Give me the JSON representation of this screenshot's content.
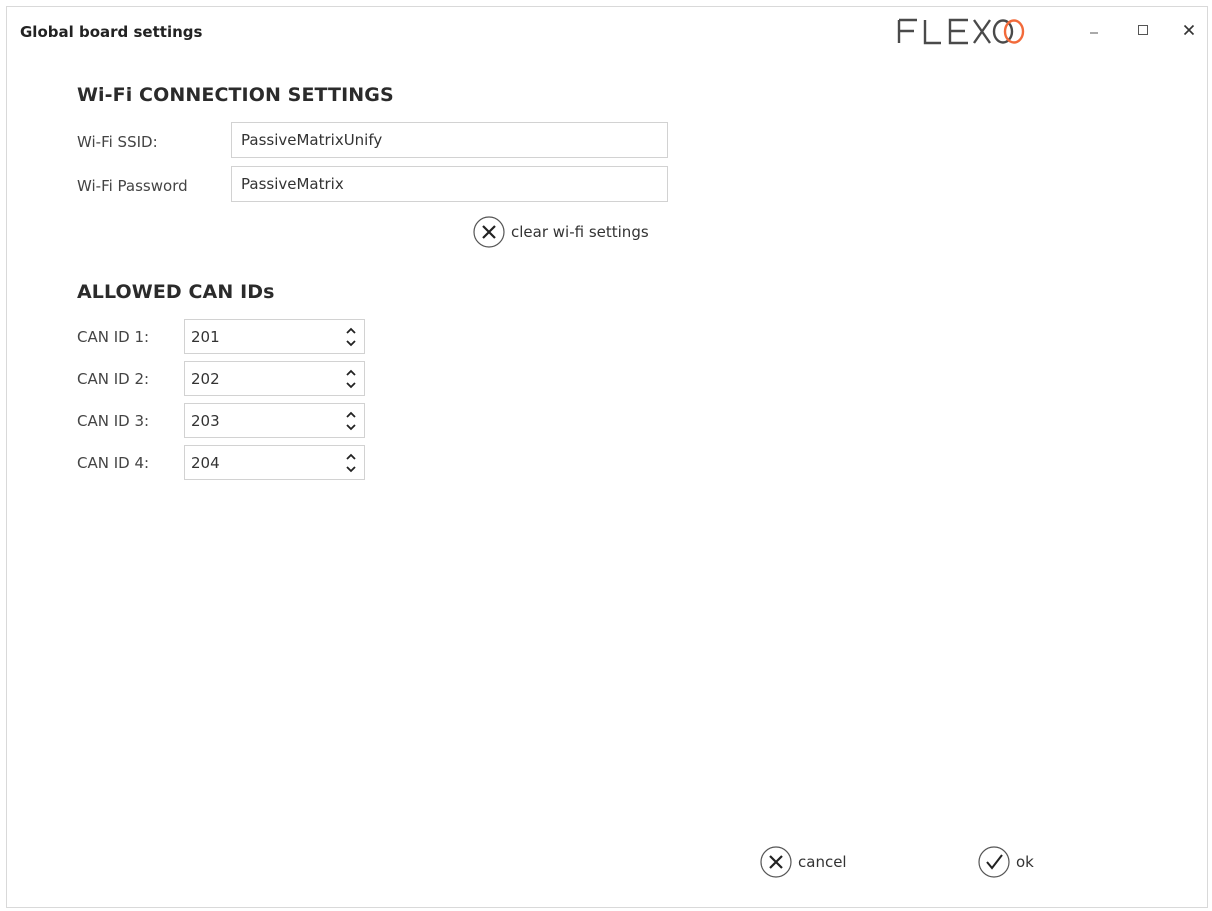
{
  "window": {
    "title": "Global board settings",
    "brand": "FLEXOO",
    "accent_color": "#f26a3a"
  },
  "wifi": {
    "heading": "Wi-Fi CONNECTION SETTINGS",
    "ssid_label": "Wi-Fi SSID:",
    "ssid_value": "PassiveMatrixUnify",
    "password_label": "Wi-Fi Password",
    "password_value": "PassiveMatrix",
    "clear_label": "clear wi-fi settings"
  },
  "can": {
    "heading": "ALLOWED CAN IDs",
    "ids": [
      {
        "label": "CAN ID 1:",
        "value": "201"
      },
      {
        "label": "CAN ID 2:",
        "value": "202"
      },
      {
        "label": "CAN ID 3:",
        "value": "203"
      },
      {
        "label": "CAN ID 4:",
        "value": "204"
      }
    ]
  },
  "footer": {
    "cancel_label": "cancel",
    "ok_label": "ok"
  }
}
